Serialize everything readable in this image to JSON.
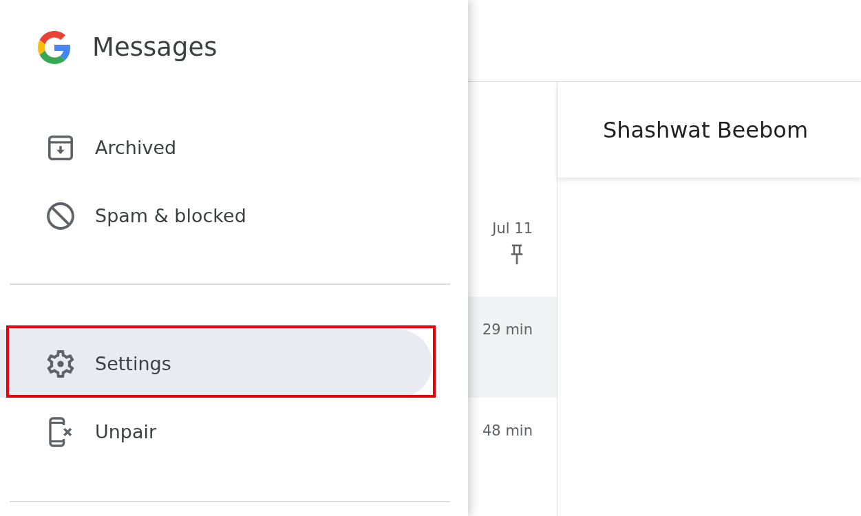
{
  "drawer": {
    "app_name": "Messages",
    "sections": [
      {
        "items": [
          {
            "label": "Archived",
            "kind": "archive",
            "selected": false,
            "highlighted": false
          },
          {
            "label": "Spam & blocked",
            "kind": "spam",
            "selected": false,
            "highlighted": false
          }
        ]
      },
      {
        "items": [
          {
            "label": "Settings",
            "kind": "settings",
            "selected": true,
            "highlighted": true
          },
          {
            "label": "Unpair",
            "kind": "unpair",
            "selected": false,
            "highlighted": false
          }
        ]
      }
    ]
  },
  "conversations": [
    {
      "time": "Jul 11",
      "pinned": true,
      "selected": false
    },
    {
      "time": "29 min",
      "pinned": false,
      "selected": true
    },
    {
      "time": "48 min",
      "pinned": false,
      "selected": false
    }
  ],
  "conversation_header": {
    "title": "Shashwat Beebom"
  }
}
